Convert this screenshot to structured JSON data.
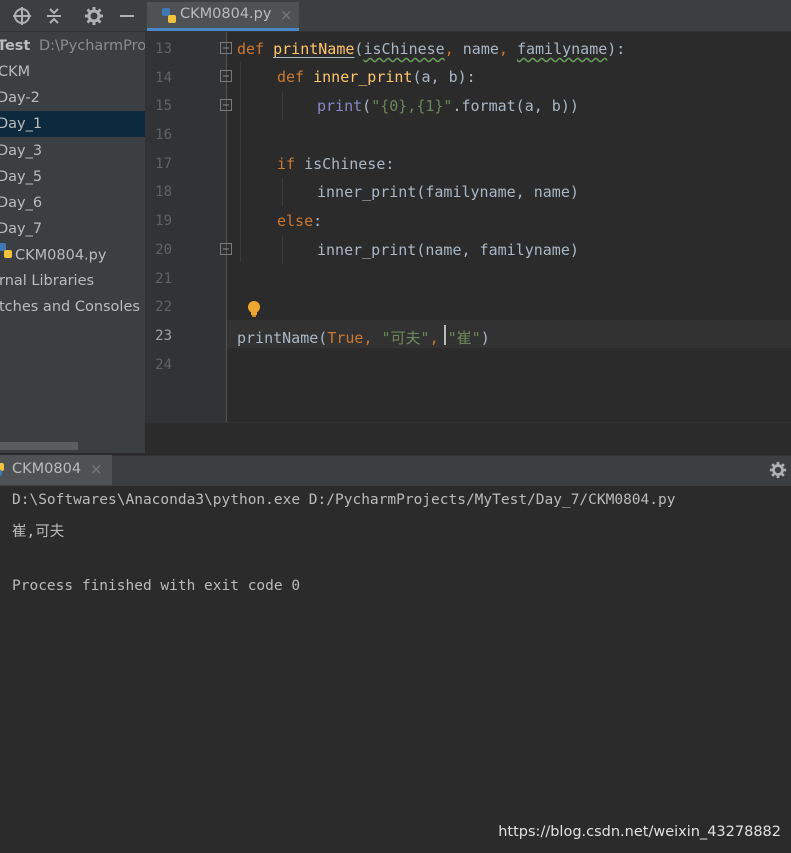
{
  "project_panel": {
    "root_name": "Test",
    "root_path": "D:\\PycharmProj",
    "items": [
      {
        "label": "CKM"
      },
      {
        "label": "Day-2"
      },
      {
        "label": "Day_1"
      },
      {
        "label": "Day_3"
      },
      {
        "label": "Day_5"
      },
      {
        "label": "Day_6"
      },
      {
        "label": "Day_7"
      },
      {
        "label": "CKM0804.py"
      },
      {
        "label": "rnal Libraries"
      },
      {
        "label": "tches and Consoles"
      }
    ],
    "selected_item": "Day_1"
  },
  "editor": {
    "tab_label": "CKM0804.py",
    "tab_close": "×",
    "line_numbers": [
      "13",
      "14",
      "15",
      "16",
      "17",
      "18",
      "19",
      "20",
      "21",
      "22",
      "23",
      "24"
    ],
    "current_line": "23",
    "code": {
      "l13": {
        "kw": "def",
        "fn": "printName",
        "p1": "(",
        "typo": "isChinese",
        "p2": ", ",
        "name": "name",
        "p3": ", ",
        "fam": "familyname",
        "p4": "):"
      },
      "l14": {
        "kw": "def",
        "fn": "inner_print",
        "rest": "(a, b):"
      },
      "l15": {
        "builtin": "print",
        "p1": "(",
        "str": "\"{0},{1}\"",
        "rest": ".format(a, b))"
      },
      "l17": {
        "kw": "if",
        "rest": " isChinese:"
      },
      "l18": {
        "rest": "inner_print(familyname, name)"
      },
      "l19": {
        "kw": "else",
        "rest": ":"
      },
      "l20": {
        "rest": "inner_print(name, familyname)"
      },
      "l23": {
        "fn_call": "printName(",
        "kw": "True",
        "p1": ", ",
        "s1": "\"可夫\"",
        "p2": ", ",
        "s2": "\"崔\"",
        "p3": ")"
      }
    }
  },
  "run_panel": {
    "tab_label": "CKM0804",
    "tab_close": "×",
    "console_lines": [
      "D:\\Softwares\\Anaconda3\\python.exe D:/PycharmProjects/MyTest/Day_7/CKM0804.py",
      "崔,可夫",
      "",
      "Process finished with exit code 0"
    ]
  },
  "watermark": "https://blog.csdn.net/weixin_43278882",
  "colors": {
    "background": "#2b2b2b",
    "panel": "#3c3f41",
    "selection": "#0d293e",
    "keyword": "#cc7832",
    "function": "#ffc66d",
    "string": "#6a8759",
    "builtin": "#8888c6"
  }
}
